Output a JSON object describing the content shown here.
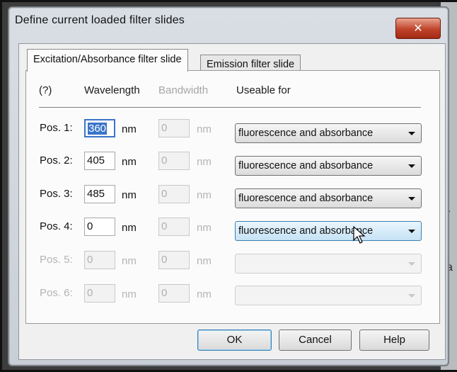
{
  "window": {
    "title": "Define current loaded filter slides",
    "close_glyph": "✕"
  },
  "tabs": [
    {
      "label": "Excitation/Absorbance filter slide",
      "active": true
    },
    {
      "label": "Emission filter slide",
      "active": false
    }
  ],
  "headers": {
    "help": "(?)",
    "wavelength": "Wavelength",
    "bandwidth": "Bandwidth",
    "useable": "Useable for"
  },
  "rows": [
    {
      "label": "Pos. 1:",
      "wavelength": "360",
      "wl_unit": "nm",
      "bandwidth": "0",
      "bw_unit": "nm",
      "useable": "fluorescence and absorbance",
      "enabled": true,
      "focused": true
    },
    {
      "label": "Pos. 2:",
      "wavelength": "405",
      "wl_unit": "nm",
      "bandwidth": "0",
      "bw_unit": "nm",
      "useable": "fluorescence and absorbance",
      "enabled": true
    },
    {
      "label": "Pos. 3:",
      "wavelength": "485",
      "wl_unit": "nm",
      "bandwidth": "0",
      "bw_unit": "nm",
      "useable": "fluorescence and absorbance",
      "enabled": true
    },
    {
      "label": "Pos. 4:",
      "wavelength": "0",
      "wl_unit": "nm",
      "bandwidth": "0",
      "bw_unit": "nm",
      "useable": "fluorescence and absorbance",
      "enabled": true,
      "hover": true
    },
    {
      "label": "Pos. 5:",
      "wavelength": "0",
      "wl_unit": "nm",
      "bandwidth": "0",
      "bw_unit": "nm",
      "useable": "",
      "enabled": false
    },
    {
      "label": "Pos. 6:",
      "wavelength": "0",
      "wl_unit": "nm",
      "bandwidth": "0",
      "bw_unit": "nm",
      "useable": "",
      "enabled": false
    }
  ],
  "buttons": {
    "ok": "OK",
    "cancel": "Cancel",
    "help": "Help"
  },
  "background_glyphs": [
    "r",
    "a"
  ],
  "colors": {
    "selection": "#3a74c9",
    "close_button": "#c0422a"
  }
}
